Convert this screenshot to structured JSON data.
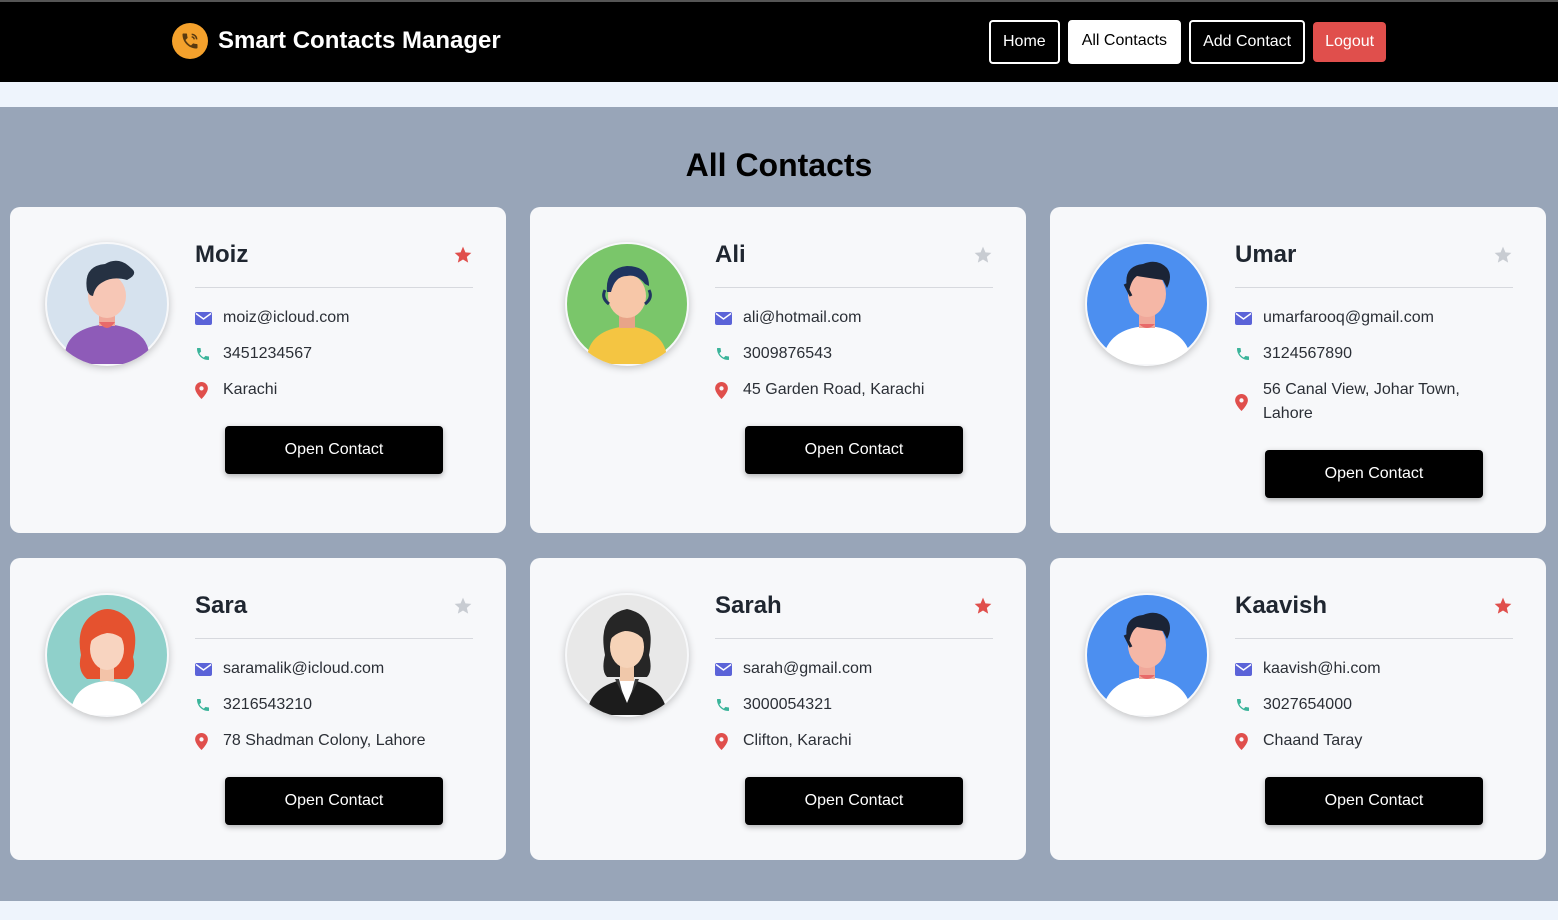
{
  "app": {
    "title": "Smart Contacts Manager",
    "logo_icon": "phone-icon"
  },
  "nav": {
    "home": "Home",
    "all_contacts": "All Contacts",
    "add_contact": "Add Contact",
    "logout": "Logout"
  },
  "page": {
    "title": "All Contacts"
  },
  "colors": {
    "navbar": "#000000",
    "brand_logo": "#f4a12c",
    "logout": "#e04f4c",
    "favorite_star": "#e04f4c",
    "unfavorite_star": "#c8ccd2",
    "email_icon": "#5b63d8",
    "phone_icon": "#3bb49a",
    "location_icon": "#e04f4c",
    "page_background": "#98a5b8"
  },
  "contacts": [
    {
      "name": "Moiz",
      "email": "moiz@icloud.com",
      "phone": "3451234567",
      "address": "Karachi",
      "favorite": true,
      "avatar": "man-dark-hair-purple-shirt",
      "button": "Open Contact"
    },
    {
      "name": "Ali",
      "email": "ali@hotmail.com",
      "phone": "3009876543",
      "address": "45 Garden Road, Karachi",
      "favorite": false,
      "avatar": "man-green-yellow",
      "button": "Open Contact"
    },
    {
      "name": "Umar",
      "email": "umarfarooq@gmail.com",
      "phone": "3124567890",
      "address": "56 Canal View, Johar Town, Lahore",
      "favorite": false,
      "avatar": "man-blue-background",
      "button": "Open Contact"
    },
    {
      "name": "Sara",
      "email": "saramalik@icloud.com",
      "phone": "3216543210",
      "address": "78 Shadman Colony, Lahore",
      "favorite": false,
      "avatar": "woman-red-hair",
      "button": "Open Contact"
    },
    {
      "name": "Sarah",
      "email": "sarah@gmail.com",
      "phone": "3000054321",
      "address": "Clifton, Karachi",
      "favorite": true,
      "avatar": "woman-business-suit",
      "button": "Open Contact"
    },
    {
      "name": "Kaavish",
      "email": "kaavish@hi.com",
      "phone": "3027654000",
      "address": "Chaand Taray",
      "favorite": true,
      "avatar": "man-blue-background",
      "button": "Open Contact"
    }
  ]
}
